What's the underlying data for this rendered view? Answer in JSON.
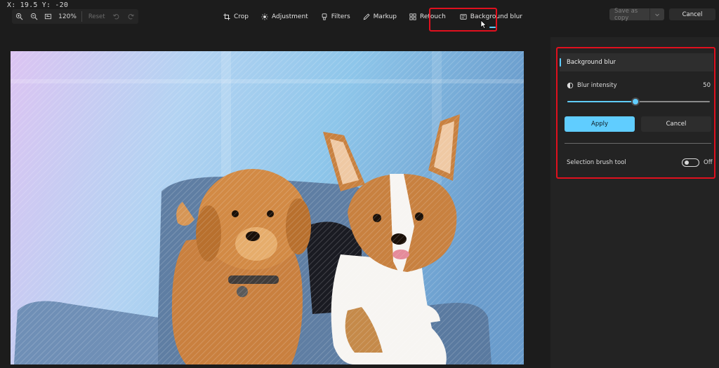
{
  "cursor_readout": "X: 19.5 Y: -20",
  "zoom": {
    "zoom_in_icon": "zoom-in-icon",
    "zoom_out_icon": "zoom-out-icon",
    "fit_icon": "fit-to-window-icon",
    "level": "120%",
    "reset_label": "Reset",
    "undo_icon": "undo-icon",
    "redo_icon": "redo-icon"
  },
  "toolbar": {
    "tools": [
      {
        "label": "Crop",
        "icon": "crop-icon"
      },
      {
        "label": "Adjustment",
        "icon": "brightness-icon"
      },
      {
        "label": "Filters",
        "icon": "filter-icon"
      },
      {
        "label": "Markup",
        "icon": "pen-icon"
      },
      {
        "label": "Retouch",
        "icon": "retouch-icon"
      },
      {
        "label": "Background blur",
        "icon": "background-blur-icon",
        "active": true
      }
    ]
  },
  "actions": {
    "save_as_copy": "Save as copy",
    "cancel": "Cancel"
  },
  "panel": {
    "header": "Background blur",
    "blur_intensity_label": "Blur intensity",
    "blur_intensity_value": "50",
    "blur_slider_fraction": 0.48,
    "apply_label": "Apply",
    "cancel_label": "Cancel",
    "brush_label": "Selection brush tool",
    "brush_state": "Off"
  },
  "colors": {
    "accent": "#60cdff",
    "highlight": "#e0101e",
    "background": "#1c1c1c",
    "panel": "#232323"
  }
}
